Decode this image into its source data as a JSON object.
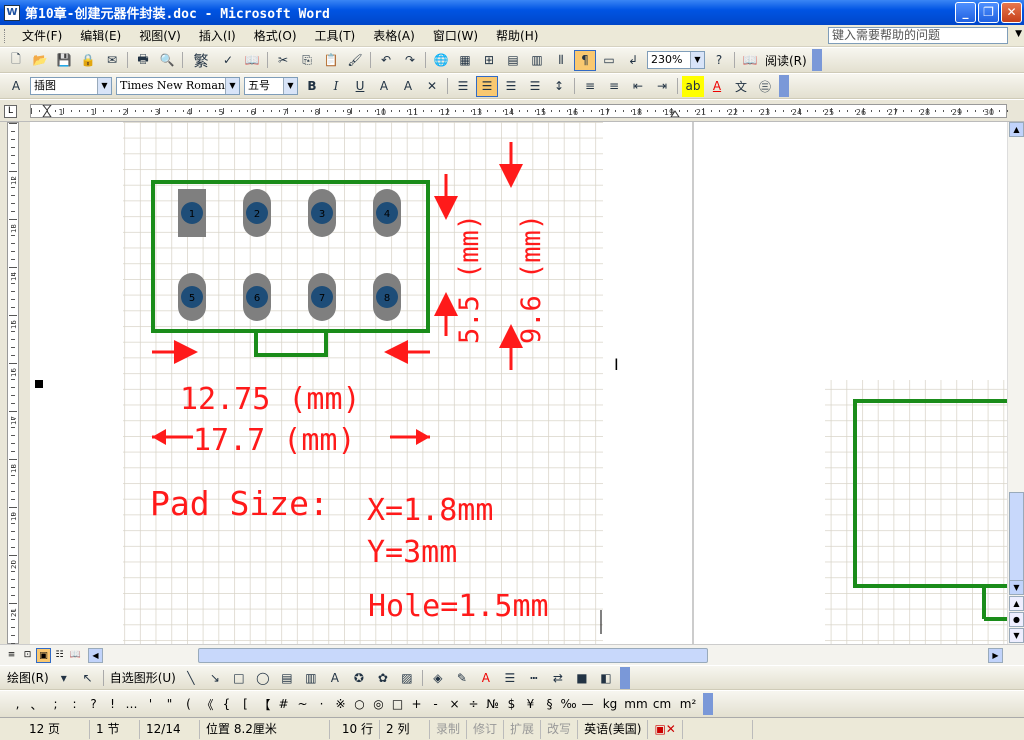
{
  "window": {
    "title": "第10章-创建元器件封装.doc - Microsoft Word",
    "app_icon": "W"
  },
  "menu": {
    "items": [
      "文件(F)",
      "编辑(E)",
      "视图(V)",
      "插入(I)",
      "格式(O)",
      "工具(T)",
      "表格(A)",
      "窗口(W)",
      "帮助(H)"
    ],
    "help_placeholder": "键入需要帮助的问题"
  },
  "toolbar1": {
    "zoom": "230%",
    "read_label": "阅读(R)",
    "trad_char": "繁"
  },
  "toolbar2": {
    "style": "插图",
    "font": "Times New Roman",
    "size": "五号"
  },
  "ruler": {
    "h_labels": [
      "1",
      "1",
      "2",
      "3",
      "4",
      "5",
      "6",
      "7",
      "8",
      "9",
      "10",
      "11",
      "12",
      "13",
      "14",
      "15",
      "16",
      "17",
      "18",
      "19",
      "21",
      "22",
      "23",
      "24",
      "25",
      "26",
      "27",
      "28",
      "29",
      "30"
    ],
    "v_labels": [
      "12",
      "13",
      "14",
      "15",
      "16",
      "17",
      "18",
      "19",
      "20",
      "21"
    ]
  },
  "drawing": {
    "pads": [
      "1",
      "2",
      "3",
      "4",
      "5",
      "6",
      "7",
      "8"
    ],
    "dim_width_inner": "12.75 (mm)",
    "dim_width_outer": "17.7 (mm)",
    "dim_h1": "5.5 (mm)",
    "dim_h2": "9.6 (mm)",
    "pad_size_label": "Pad Size:",
    "pad_x": "X=1.8mm",
    "pad_y": "Y=3mm",
    "hole": "Hole=1.5mm",
    "colors": {
      "outline": "#1a8c1a",
      "dimension": "#ff1a1a",
      "pad": "#7f7f7f",
      "hole": "#1e4d78",
      "grid": "#d8d4c8"
    }
  },
  "drawbar": {
    "draw_label": "绘图(R)",
    "autoshape_label": "自选图形(U)"
  },
  "symbols": [
    ",",
    "、",
    ";",
    ":",
    "?",
    "!",
    "…",
    "'",
    "\"",
    "(",
    "《",
    "{",
    "[",
    "【",
    "#",
    "~",
    "·",
    "※",
    "○",
    "◎",
    "□",
    "+",
    "-",
    "×",
    "÷",
    "№",
    "$",
    "¥",
    "§",
    "‰",
    "—",
    "kg",
    "mm",
    "cm",
    "m²"
  ],
  "status": {
    "page": "12 页",
    "section": "1 节",
    "page_of": "12/14",
    "position": "位置 8.2厘米",
    "line": "10 行",
    "col": "2 列",
    "rec": "录制",
    "trk": "修订",
    "ext": "扩展",
    "ovr": "改写",
    "lang": "英语(美国)"
  }
}
